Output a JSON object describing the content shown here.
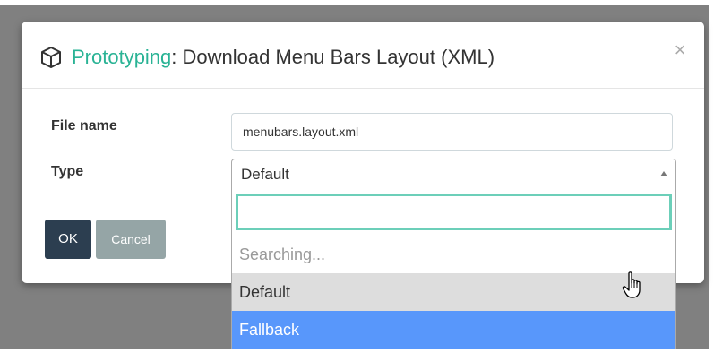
{
  "dialog": {
    "title_accent": "Prototyping",
    "title_rest": ": Download Menu Bars Layout (XML)",
    "close_label": "×",
    "accent_color": "#2ab395"
  },
  "form": {
    "file_name_label": "File name",
    "file_name_value": "menubars.layout.xml",
    "type_label": "Type",
    "type_value": "Default"
  },
  "buttons": {
    "ok": "OK",
    "cancel": "Cancel"
  },
  "dropdown": {
    "search_value": "",
    "status": "Searching...",
    "options": [
      {
        "label": "Default",
        "state": "hover"
      },
      {
        "label": "Fallback",
        "state": "highlighted"
      }
    ],
    "highlight_color": "#5897fb"
  },
  "icons": {
    "title_icon": "cube-icon",
    "cursor": "hand-pointer-icon"
  }
}
